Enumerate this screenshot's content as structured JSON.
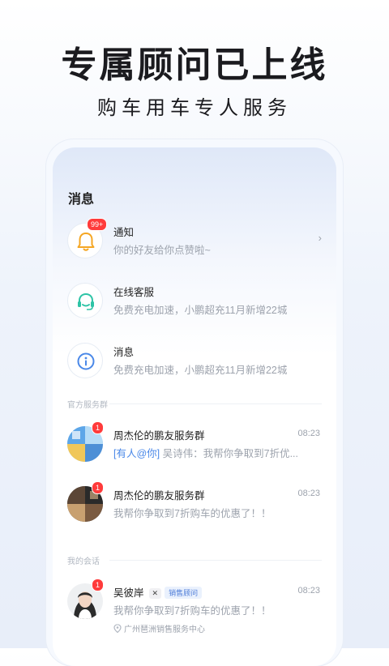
{
  "headline": "专属顾问已上线",
  "subline": "购车用车专人服务",
  "screen": {
    "title": "消息",
    "notifications": {
      "name": "通知",
      "desc": "你的好友给你点赞啦~",
      "badge": "99+",
      "icon": "bell-icon"
    },
    "service": {
      "name": "在线客服",
      "desc": "免费充电加速，小鹏超充11月新增22城",
      "icon": "headset-icon"
    },
    "messages": {
      "name": "消息",
      "desc": "免费充电加速，小鹏超充11月新增22城",
      "icon": "info-icon"
    },
    "official_section": "官方服务群",
    "groups": [
      {
        "name": "周杰伦的鹏友服务群",
        "mention": "[有人@你]",
        "desc": " 吴诗伟：我帮你争取到7折优...",
        "time": "08:23",
        "badge": "1"
      },
      {
        "name": "周杰伦的鹏友服务群",
        "desc": "我帮你争取到7折购车的优惠了！！",
        "time": "08:23",
        "badge": "1"
      }
    ],
    "my_section": "我的会话",
    "chat": {
      "name": "吴彼岸",
      "logo": "✕",
      "role": "销售顾问",
      "desc": "我帮你争取到7折购车的优惠了！！",
      "time": "08:23",
      "badge": "1",
      "location": "广州琶洲销售服务中心"
    }
  },
  "colors": {
    "badge": "#ff3b3b",
    "bell": "#f5a623",
    "headset": "#2ec4a6",
    "info": "#4a88e8",
    "mention": "#4a88e8"
  }
}
